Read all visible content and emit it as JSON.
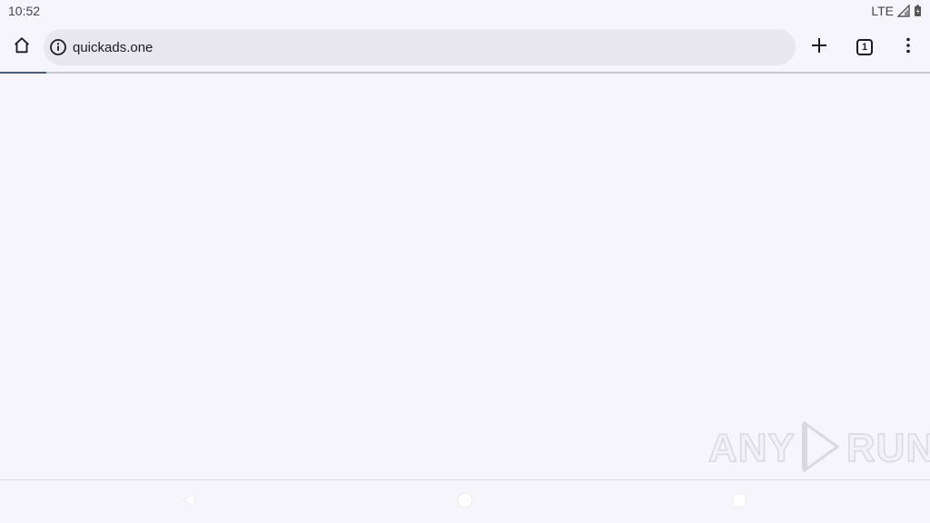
{
  "status_bar": {
    "time": "10:52",
    "network": "LTE"
  },
  "toolbar": {
    "url": "quickads.one",
    "tab_count": "1",
    "icons": [
      "home-icon",
      "info-icon",
      "plus-icon",
      "tab-switcher-icon",
      "more-vert-icon"
    ]
  },
  "page_load_progress": 0.05,
  "watermark": {
    "left": "ANY",
    "right": "RUN"
  },
  "nav_bar": {
    "icons": [
      "back-icon",
      "home-circle-icon",
      "recents-icon"
    ]
  },
  "colors": {
    "background": "#f7f5fc",
    "omnibox": "#e8e6ee",
    "progress": "#4a5a80"
  }
}
